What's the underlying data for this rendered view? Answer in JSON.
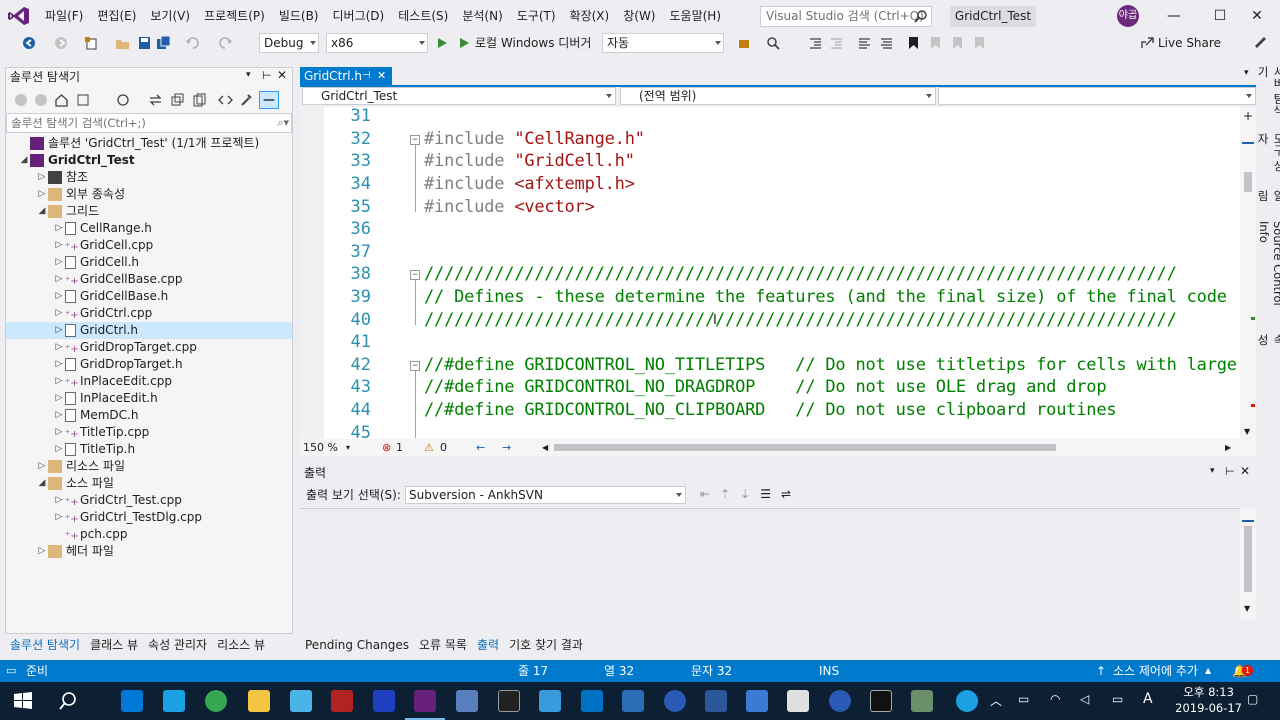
{
  "window": {
    "menu": [
      "파일(F)",
      "편집(E)",
      "보기(V)",
      "프로젝트(P)",
      "빌드(B)",
      "디버그(D)",
      "테스트(S)",
      "분석(N)",
      "도구(T)",
      "확장(X)",
      "창(W)",
      "도움말(H)"
    ],
    "search_placeholder": "Visual Studio 검색 (Ctrl+Q)",
    "solution_name": "GridCtrl_Test",
    "avatar_initials": "야곱",
    "minimize": "—",
    "maximize": "☐",
    "close": "✕"
  },
  "toolbar": {
    "config": "Debug",
    "platform": "x86",
    "run_label": "로컬 Windows 디버거",
    "run_mode": "자동",
    "live_share": "Live Share"
  },
  "solution_explorer": {
    "title": "솔루션 탐색기",
    "search_placeholder": "솔루션 탐색기 검색(Ctrl+;)",
    "items": [
      {
        "label": "솔루션 'GridCtrl_Test' (1/1개 프로젝트)",
        "level": 0,
        "tri": "",
        "icon": "solution-icon"
      },
      {
        "label": "GridCtrl_Test",
        "level": 0,
        "tri": "◢",
        "icon": "project-icon",
        "bold": true
      },
      {
        "label": "참조",
        "level": 1,
        "tri": "▷",
        "icon": "references-icon"
      },
      {
        "label": "외부 종속성",
        "level": 1,
        "tri": "▷",
        "icon": "folder-icon"
      },
      {
        "label": "그리드",
        "level": 1,
        "tri": "◢",
        "icon": "folder-icon"
      },
      {
        "label": "CellRange.h",
        "level": 2,
        "tri": "▷",
        "icon": "header-file-icon"
      },
      {
        "label": "GridCell.cpp",
        "level": 2,
        "tri": "▷",
        "icon": "cpp-file-icon"
      },
      {
        "label": "GridCell.h",
        "level": 2,
        "tri": "▷",
        "icon": "header-file-icon"
      },
      {
        "label": "GridCellBase.cpp",
        "level": 2,
        "tri": "▷",
        "icon": "cpp-file-icon"
      },
      {
        "label": "GridCellBase.h",
        "level": 2,
        "tri": "▷",
        "icon": "header-file-icon"
      },
      {
        "label": "GridCtrl.cpp",
        "level": 2,
        "tri": "▷",
        "icon": "cpp-file-icon"
      },
      {
        "label": "GridCtrl.h",
        "level": 2,
        "tri": "▷",
        "icon": "header-file-icon",
        "selected": true
      },
      {
        "label": "GridDropTarget.cpp",
        "level": 2,
        "tri": "▷",
        "icon": "cpp-file-icon"
      },
      {
        "label": "GridDropTarget.h",
        "level": 2,
        "tri": "▷",
        "icon": "header-file-icon"
      },
      {
        "label": "InPlaceEdit.cpp",
        "level": 2,
        "tri": "▷",
        "icon": "cpp-file-icon"
      },
      {
        "label": "InPlaceEdit.h",
        "level": 2,
        "tri": "▷",
        "icon": "header-file-icon"
      },
      {
        "label": "MemDC.h",
        "level": 2,
        "tri": "▷",
        "icon": "header-file-icon"
      },
      {
        "label": "TitleTip.cpp",
        "level": 2,
        "tri": "▷",
        "icon": "cpp-file-icon"
      },
      {
        "label": "TitleTip.h",
        "level": 2,
        "tri": "▷",
        "icon": "header-file-icon"
      },
      {
        "label": "리소스 파일",
        "level": 1,
        "tri": "▷",
        "icon": "folder-icon"
      },
      {
        "label": "소스 파일",
        "level": 1,
        "tri": "◢",
        "icon": "folder-icon"
      },
      {
        "label": "GridCtrl_Test.cpp",
        "level": 2,
        "tri": "▷",
        "icon": "cpp-file-icon"
      },
      {
        "label": "GridCtrl_TestDlg.cpp",
        "level": 2,
        "tri": "▷",
        "icon": "cpp-file-icon"
      },
      {
        "label": "pch.cpp",
        "level": 2,
        "tri": "",
        "icon": "cpp-file-icon"
      },
      {
        "label": "헤더 파일",
        "level": 1,
        "tri": "▷",
        "icon": "folder-icon"
      }
    ],
    "bottom_tabs": [
      "솔루션 탐색기",
      "클래스 뷰",
      "속성 관리자",
      "리소스 뷰"
    ]
  },
  "editor": {
    "tab_label": "GridCtrl.h",
    "scope_combo": "GridCtrl_Test",
    "member_combo": "(전역 범위)",
    "lines": [
      {
        "n": "31",
        "fold": "",
        "parts": []
      },
      {
        "n": "32",
        "fold": "⊟",
        "parts": [
          {
            "t": "#include ",
            "c": "c-pre"
          },
          {
            "t": "\"CellRange.h\"",
            "c": "c-str"
          }
        ]
      },
      {
        "n": "33",
        "fold": "",
        "parts": [
          {
            "t": "#include ",
            "c": "c-pre"
          },
          {
            "t": "\"GridCell.h\"",
            "c": "c-str"
          }
        ]
      },
      {
        "n": "34",
        "fold": "",
        "parts": [
          {
            "t": "#include ",
            "c": "c-pre"
          },
          {
            "t": "<afxtempl.h>",
            "c": "c-str"
          }
        ]
      },
      {
        "n": "35",
        "fold": "",
        "parts": [
          {
            "t": "#include ",
            "c": "c-pre"
          },
          {
            "t": "<vector>",
            "c": "c-str"
          }
        ]
      },
      {
        "n": "36",
        "fold": "",
        "parts": []
      },
      {
        "n": "37",
        "fold": "",
        "parts": []
      },
      {
        "n": "38",
        "fold": "⊟",
        "parts": [
          {
            "t": "///////////////////////////////////////////////////////////////////////////",
            "c": "c-com"
          }
        ]
      },
      {
        "n": "39",
        "fold": "",
        "parts": [
          {
            "t": "// Defines - these determine the features (and the final size) of the final code",
            "c": "c-com"
          }
        ]
      },
      {
        "n": "40",
        "fold": "",
        "parts": [
          {
            "t": "///////////////////////////////////////////////////////////////////////////",
            "c": "c-com"
          }
        ]
      },
      {
        "n": "41",
        "fold": "",
        "parts": []
      },
      {
        "n": "42",
        "fold": "⊟",
        "parts": [
          {
            "t": "//#define GRIDCONTROL_NO_TITLETIPS   // Do not use titletips for cells with large data",
            "c": "c-com"
          }
        ]
      },
      {
        "n": "43",
        "fold": "",
        "parts": [
          {
            "t": "//#define GRIDCONTROL_NO_DRAGDROP    // Do not use OLE drag and drop",
            "c": "c-com"
          }
        ]
      },
      {
        "n": "44",
        "fold": "",
        "parts": [
          {
            "t": "//#define GRIDCONTROL_NO_CLIPBOARD   // Do not use clipboard routines",
            "c": "c-com"
          }
        ]
      },
      {
        "n": "45",
        "fold": "",
        "parts": []
      }
    ],
    "zoom": "150 %",
    "errors": "1",
    "warnings": "0"
  },
  "output": {
    "title": "출력",
    "source_label": "출력 보기 선택(S):",
    "source_value": "Subversion - AnkhSVN",
    "bottom_tabs": [
      "Pending Changes",
      "오류 목록",
      "출력",
      "기호 찾기 결과"
    ]
  },
  "side_tabs": [
    "서버 탐색기",
    "도구 상자",
    "알림",
    "Source Control Info",
    "속성"
  ],
  "status": {
    "ready": "준비",
    "line": "줄 17",
    "col": "열 32",
    "ch": "문자 32",
    "ins": "INS",
    "source_control": "소스 제어에 추가",
    "notifications": "1"
  },
  "taskbar": {
    "time": "오후 8:13",
    "date": "2019-06-17",
    "ime": "A"
  },
  "colors": {
    "accent": "#007acc",
    "line_number": "#2b91af",
    "comment": "#008000",
    "string": "#a31515",
    "preprocessor": "#808080"
  }
}
